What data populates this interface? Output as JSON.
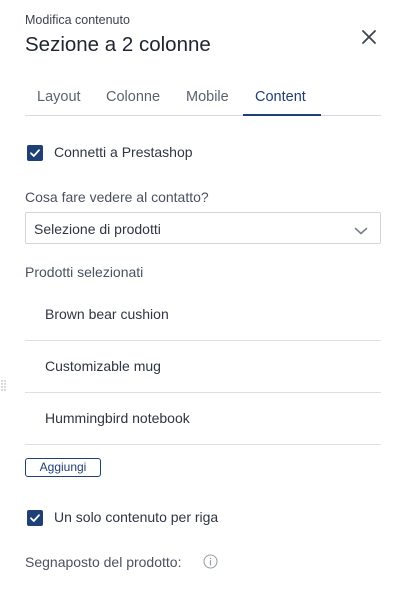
{
  "header": {
    "subtitle": "Modifica contenuto",
    "title": "Sezione a 2 colonne",
    "close_icon": "close-icon"
  },
  "tabs": [
    {
      "label": "Layout",
      "active": false
    },
    {
      "label": "Colonne",
      "active": false
    },
    {
      "label": "Mobile",
      "active": false
    },
    {
      "label": "Content",
      "active": true
    }
  ],
  "content": {
    "connect_checkbox": {
      "label": "Connetti a Prestashop",
      "checked": true
    },
    "display_question": "Cosa fare vedere al contatto?",
    "display_select": {
      "value": "Selezione di prodotti",
      "icon": "chevron-down-icon"
    },
    "selected_products_label": "Prodotti selezionati",
    "products": [
      "Brown bear cushion",
      "Customizable mug",
      "Hummingbird notebook"
    ],
    "add_button": "Aggiungi",
    "single_per_row_checkbox": {
      "label": "Un solo contenuto per riga",
      "checked": true
    },
    "placeholder_label": "Segnaposto del prodotto:",
    "info_icon": "info-icon"
  },
  "colors": {
    "accent": "#1f3f77",
    "text": "#2f3542",
    "divider": "#dcdfe3"
  }
}
